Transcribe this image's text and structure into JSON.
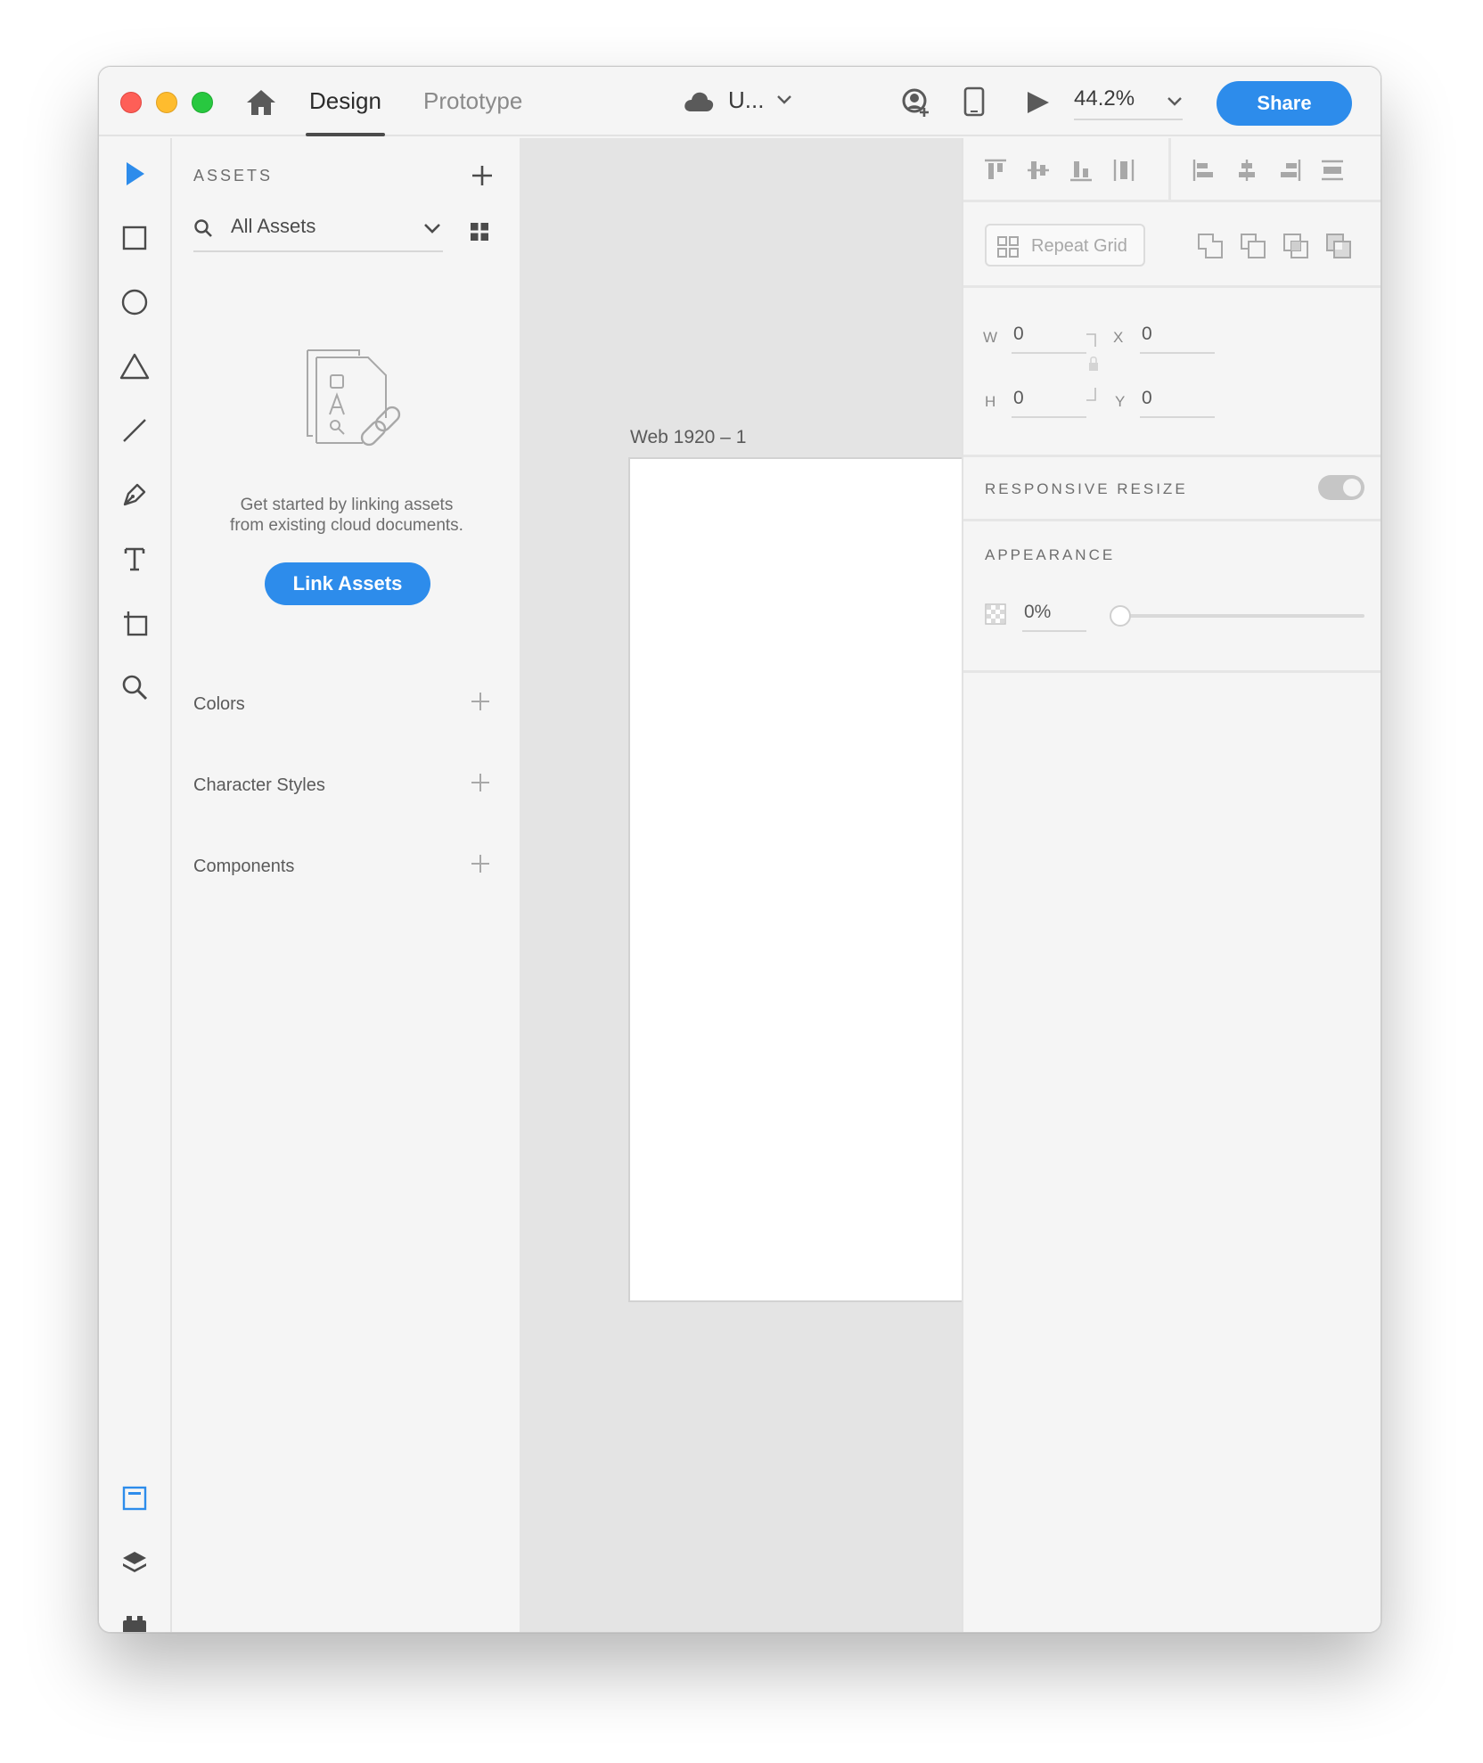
{
  "window": {
    "tabs": {
      "design": "Design",
      "prototype": "Prototype"
    },
    "document_title": "U...",
    "zoom": "44.2%",
    "share_label": "Share"
  },
  "toolbar": {
    "tools": [
      "select-icon",
      "rectangle-icon",
      "ellipse-icon",
      "polygon-icon",
      "line-icon",
      "pen-icon",
      "text-icon",
      "artboard-icon",
      "zoom-icon"
    ],
    "bottom": [
      "assets-panel-icon",
      "layers-icon",
      "plugins-icon"
    ],
    "active_color": "#2d8ceb"
  },
  "assets": {
    "title": "ASSETS",
    "filter": "All Assets",
    "empty_text_line1": "Get started by linking assets",
    "empty_text_line2": "from existing cloud documents.",
    "link_button": "Link Assets",
    "sections": [
      {
        "label": "Colors"
      },
      {
        "label": "Character Styles"
      },
      {
        "label": "Components"
      }
    ]
  },
  "canvas": {
    "artboard_label": "Web 1920 – 1"
  },
  "inspector": {
    "repeat_grid_label": "Repeat Grid",
    "transform": {
      "w_label": "W",
      "w_value": "0",
      "h_label": "H",
      "h_value": "0",
      "x_label": "X",
      "x_value": "0",
      "y_label": "Y",
      "y_value": "0"
    },
    "responsive_resize_label": "RESPONSIVE RESIZE",
    "responsive_resize_on": true,
    "appearance_label": "APPEARANCE",
    "opacity_value": "0%",
    "opacity_fraction": 0.0
  },
  "colors": {
    "accent": "#2d8ceb",
    "close": "#fe5f57",
    "minimize": "#febc2e",
    "maximize": "#28c840"
  }
}
